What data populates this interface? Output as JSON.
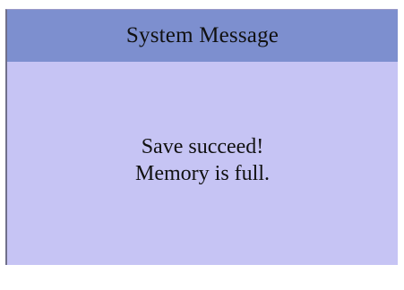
{
  "dialog": {
    "title": "System Message",
    "message_lines": [
      "Save succeed!",
      "Memory is full."
    ]
  },
  "colors": {
    "title_bar": "#7d8fcf",
    "body_background": "#c6c4f4",
    "text": "#111111"
  }
}
